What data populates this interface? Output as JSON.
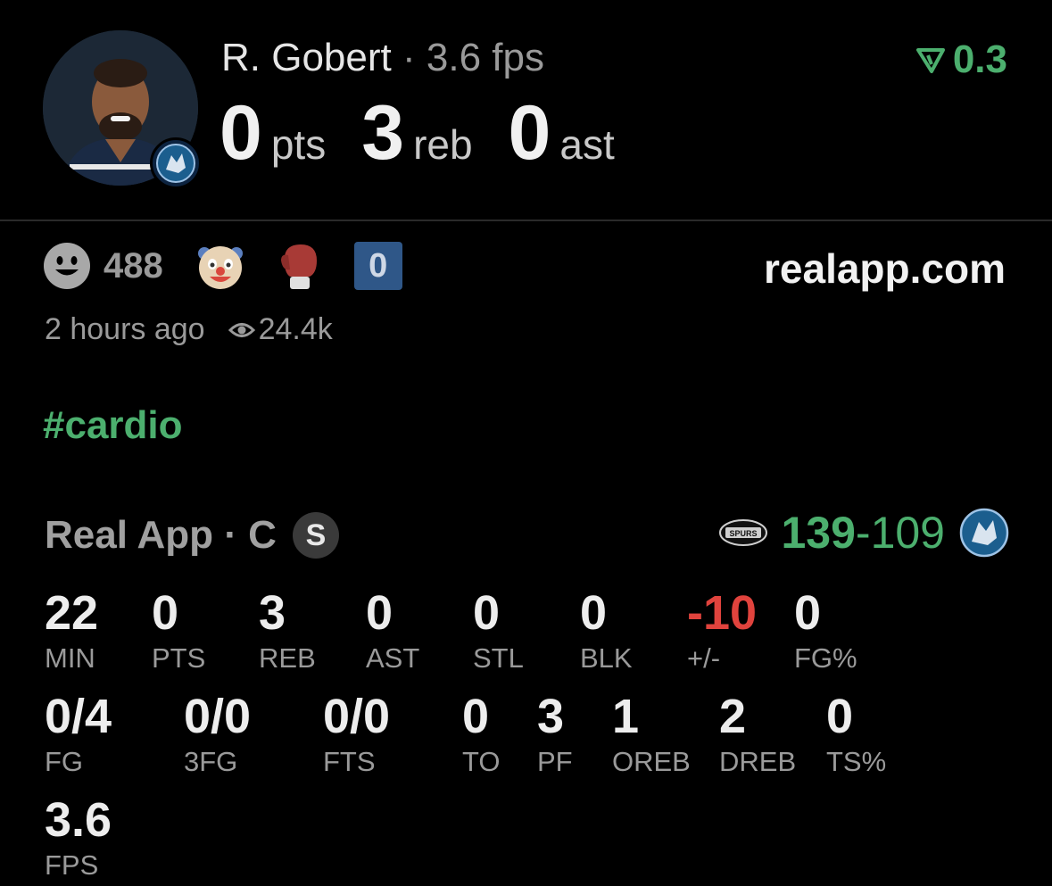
{
  "header": {
    "player_name": "R. Gobert",
    "separator": "·",
    "fps_label": "3.6 fps",
    "stats": [
      {
        "value": "0",
        "unit": "pts"
      },
      {
        "value": "3",
        "unit": "reb"
      },
      {
        "value": "0",
        "unit": "ast"
      }
    ],
    "rating": "0.3",
    "colors": {
      "accent": "#4caf6e",
      "negative": "#e0433d"
    }
  },
  "reactions": {
    "smiley_count": "488",
    "emojis": [
      "clown-face",
      "boxing-glove"
    ],
    "zero_badge": "0"
  },
  "site": "realapp.com",
  "meta": {
    "time": "2 hours ago",
    "views": "24.4k"
  },
  "hashtag": "#cardio",
  "game": {
    "source": "Real App",
    "position": "C",
    "starter_badge": "S",
    "score_high": "139",
    "score_dash": "-",
    "score_low": "109",
    "opponent_logo": "spurs-logo",
    "team_logo": "timberwolves-logo"
  },
  "box": {
    "row1": [
      {
        "value": "22",
        "label": "MIN"
      },
      {
        "value": "0",
        "label": "PTS"
      },
      {
        "value": "3",
        "label": "REB"
      },
      {
        "value": "0",
        "label": "AST"
      },
      {
        "value": "0",
        "label": "STL"
      },
      {
        "value": "0",
        "label": "BLK"
      },
      {
        "value": "-10",
        "label": "+/-"
      },
      {
        "value": "0",
        "label": "FG%"
      }
    ],
    "row2": [
      {
        "value": "0/4",
        "label": "FG"
      },
      {
        "value": "0/0",
        "label": "3FG"
      },
      {
        "value": "0/0",
        "label": "FTS"
      },
      {
        "value": "0",
        "label": "TO"
      },
      {
        "value": "3",
        "label": "PF"
      },
      {
        "value": "1",
        "label": "OREB"
      },
      {
        "value": "2",
        "label": "DREB"
      },
      {
        "value": "0",
        "label": "TS%"
      }
    ],
    "row3": [
      {
        "value": "3.6",
        "label": "FPS"
      }
    ]
  }
}
